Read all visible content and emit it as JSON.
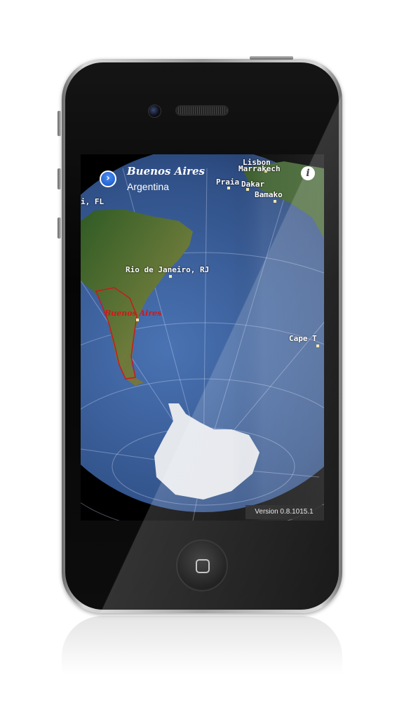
{
  "app": {
    "location": {
      "city": "Buenos Aires",
      "country": "Argentina"
    },
    "map_labels": {
      "fl": "i, FL",
      "lisbon": "Lisbon",
      "marrakech": "Marrakech",
      "praia": "Praia",
      "dakar": "Dakar",
      "bamako": "Bamako",
      "rio": "Rio de Janeiro, RJ",
      "buenos_aires": "Buenos Aires",
      "cape_town": "Cape T"
    },
    "version": "Version 0.8.1015.1"
  },
  "icons": {
    "location_button": "chevron-right-icon",
    "info_button": "info-icon",
    "home_button": "home-icon"
  },
  "colors": {
    "ocean": "#3b5d96",
    "land": "#4f7a35",
    "ice": "#e4e7ec",
    "selected_city": "#d01818",
    "location_button": "#1652c4"
  }
}
